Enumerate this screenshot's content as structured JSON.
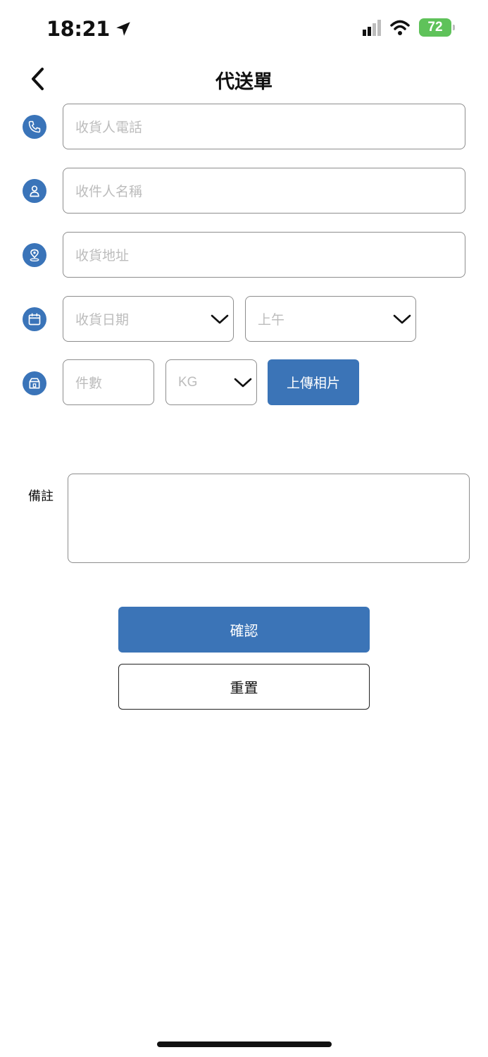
{
  "status_bar": {
    "time": "18:21",
    "battery": "72"
  },
  "header": {
    "title": "代送單"
  },
  "form": {
    "phone_placeholder": "收貨人電話",
    "name_placeholder": "收件人名稱",
    "address_placeholder": "收貨地址",
    "date_placeholder": "收貨日期",
    "time_slot_value": "上午",
    "quantity_placeholder": "件數",
    "unit_value": "KG",
    "upload_label": "上傳相片",
    "remark_label": "備註",
    "remark_value": ""
  },
  "actions": {
    "confirm_label": "確認",
    "reset_label": "重置"
  },
  "icons": {
    "back": "chevron-left-icon",
    "phone": "phone-icon",
    "person": "person-icon",
    "location": "location-pin-icon",
    "calendar": "calendar-icon",
    "package": "package-icon",
    "dropdown": "chevron-down-icon"
  },
  "colors": {
    "accent": "#3b74b7",
    "battery": "#5fc25a",
    "placeholder": "#bcbcbc",
    "border": "#8d8d8d"
  }
}
